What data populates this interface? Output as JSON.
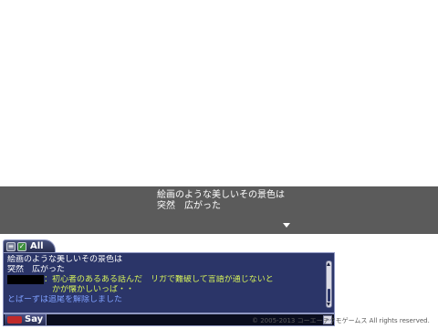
{
  "dialogue": {
    "line1": "絵画のような美しいその景色は",
    "line2": "突然　広がった"
  },
  "chat": {
    "tab_label": "All",
    "lines": [
      {
        "text": "絵画のような美しいその景色は",
        "color": "#ffffff"
      },
      {
        "text": "突然　広がった",
        "color": "#ffffff"
      },
      {
        "text": "：初心者のあるある話んだ　リガで難破して言語が通じないと",
        "color": "#d6f25a"
      },
      {
        "text": "　かが懐かしいっぱ・・",
        "color": "#d6f25a"
      },
      {
        "text": "とぱーずは追尾を解除しました",
        "color": "#7fa0ff"
      }
    ]
  },
  "input": {
    "say_label": "Say"
  },
  "copyright": "© 2005-2013 コーエーテクモゲームス All rights reserved.",
  "colors": {
    "chat_background": "#2b3568",
    "dialogue_background": "#5b5b5b",
    "speech_green": "#d6f25a",
    "system_blue": "#7fa0ff"
  },
  "icons": {
    "tab_filter": "filter-icon",
    "tab_check": "check-icon",
    "say": "megaphone-icon",
    "dialogue_next": "next-arrow-icon"
  }
}
